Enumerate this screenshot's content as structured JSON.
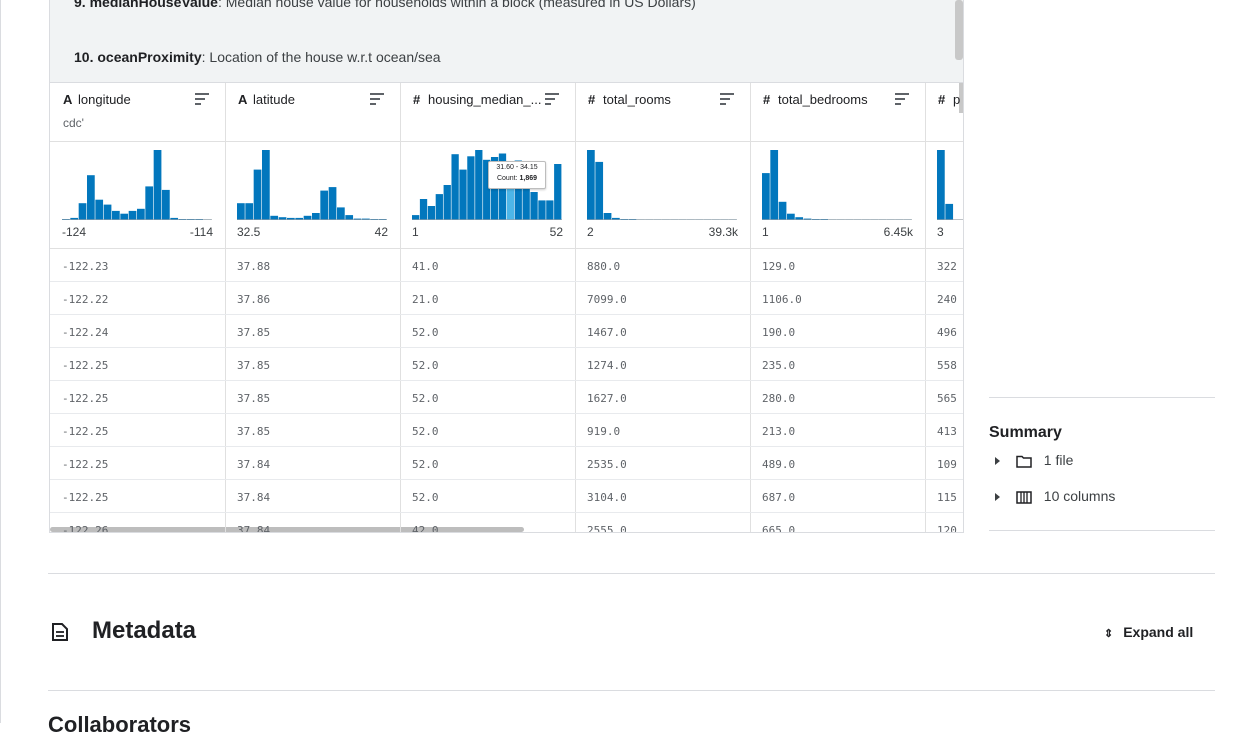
{
  "description": {
    "line9": {
      "num": "9.",
      "name": "medianHouseValue",
      "text": ": Median house value for households within a block (measured in US Dollars)"
    },
    "line10": {
      "num": "10.",
      "name": "oceanProximity",
      "text": ": Location of the house w.r.t ocean/sea"
    }
  },
  "columns": [
    {
      "type_icon": "A",
      "name": "longitude",
      "sub": "cdc'",
      "min": "-124",
      "max": "-114",
      "hist": [
        0.01,
        0.03,
        0.24,
        0.64,
        0.29,
        0.22,
        0.13,
        0.09,
        0.13,
        0.16,
        0.48,
        1.0,
        0.43,
        0.03,
        0.01,
        0.01,
        0.01,
        0.0
      ],
      "values": [
        "-122.23",
        "-122.22",
        "-122.24",
        "-122.25",
        "-122.25",
        "-122.25",
        "-122.25",
        "-122.25",
        "-122.26"
      ]
    },
    {
      "type_icon": "A",
      "name": "latitude",
      "sub": "",
      "min": "32.5",
      "max": "42",
      "hist": [
        0.24,
        0.24,
        0.72,
        1.0,
        0.06,
        0.04,
        0.03,
        0.03,
        0.06,
        0.1,
        0.42,
        0.47,
        0.18,
        0.07,
        0.02,
        0.02,
        0.01,
        0.01
      ],
      "values": [
        "37.88",
        "37.86",
        "37.85",
        "37.85",
        "37.85",
        "37.85",
        "37.84",
        "37.84",
        "37.84"
      ]
    },
    {
      "type_icon": "#",
      "name": "housing_median_...",
      "sub": "",
      "min": "1",
      "max": "52",
      "hist": [
        0.07,
        0.3,
        0.2,
        0.37,
        0.5,
        0.94,
        0.72,
        0.91,
        1.0,
        0.86,
        0.9,
        0.95,
        0.82,
        0.85,
        0.59,
        0.4,
        0.28,
        0.28,
        0.8
      ],
      "values": [
        "41.0",
        "21.0",
        "52.0",
        "52.0",
        "52.0",
        "52.0",
        "52.0",
        "52.0",
        "42.0"
      ]
    },
    {
      "type_icon": "#",
      "name": "total_rooms",
      "sub": "",
      "min": "2",
      "max": "39.3k",
      "hist": [
        1.0,
        0.83,
        0.1,
        0.03,
        0.01,
        0.01,
        0.0,
        0.0,
        0.0,
        0.0,
        0.0,
        0.0,
        0.0,
        0.0,
        0.0,
        0.0,
        0.0,
        0.0
      ],
      "values": [
        "880.0",
        "7099.0",
        "1467.0",
        "1274.0",
        "1627.0",
        "919.0",
        "2535.0",
        "3104.0",
        "2555.0"
      ]
    },
    {
      "type_icon": "#",
      "name": "total_bedrooms",
      "sub": "",
      "min": "1",
      "max": "6.45k",
      "hist": [
        0.67,
        1.0,
        0.26,
        0.09,
        0.04,
        0.02,
        0.01,
        0.01,
        0.0,
        0.0,
        0.0,
        0.0,
        0.0,
        0.0,
        0.0,
        0.0,
        0.0,
        0.0
      ],
      "values": [
        "129.0",
        "1106.0",
        "190.0",
        "235.0",
        "280.0",
        "213.0",
        "489.0",
        "687.0",
        "665.0"
      ]
    },
    {
      "type_icon": "#",
      "name": "p",
      "sub": "",
      "min": "3",
      "max": "",
      "hist": [
        1.0,
        0.23
      ],
      "values": [
        "322",
        "240",
        "496",
        "558",
        "565",
        "413",
        "109",
        "115",
        "120"
      ]
    }
  ],
  "tooltip": {
    "range": "31.60 - 34.15",
    "count_label": "Count:",
    "count_value": "1,869"
  },
  "summary": {
    "title": "Summary",
    "items": [
      {
        "icon": "folder-icon",
        "label": "1 file"
      },
      {
        "icon": "columns-icon",
        "label": "10 columns"
      }
    ]
  },
  "metadata": {
    "title": "Metadata",
    "expand_label": "Expand all",
    "next_section_cut": "Collaborators"
  },
  "colors": {
    "bar": "#0277bd",
    "highlight": "#4db6e8",
    "border": "#dadce0"
  }
}
